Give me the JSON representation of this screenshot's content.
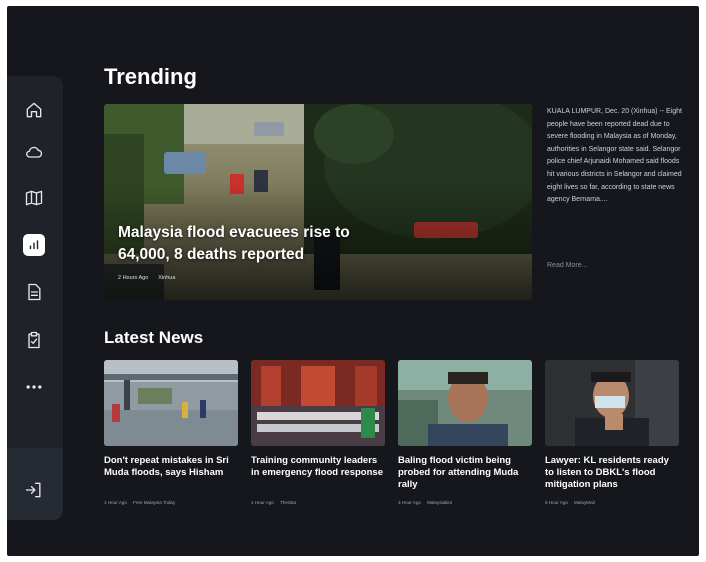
{
  "sections": {
    "trending": "Trending",
    "latest": "Latest News"
  },
  "sidebar": {
    "items": [
      {
        "icon": "home-icon"
      },
      {
        "icon": "cloud-icon"
      },
      {
        "icon": "map-icon"
      },
      {
        "icon": "chart-icon",
        "active": true
      },
      {
        "icon": "document-icon"
      },
      {
        "icon": "clipboard-check-icon"
      },
      {
        "icon": "more-icon"
      }
    ],
    "logout_icon": "logout-icon"
  },
  "featured": {
    "title": "Malaysia flood evacuees rise to 64,000, 8 deaths reported",
    "time": "2 Hours Ago",
    "source": "Xinhua",
    "body": "KUALA LUMPUR, Dec. 20 (Xinhua) -- Eight people have been reported dead due to severe flooding in Malaysia as of Monday, authorities in Selangor state said. Selangor police chief Arjunaidi Mohamed said floods hit various districts in Selangor and claimed eight lives so far, according to state news agency Bernama....",
    "read_more": "Read More..."
  },
  "latest": [
    {
      "title": "Don't repeat mistakes in Sri Muda floods, says Hisham",
      "time": "1 Hour Ago",
      "source": "Free Malaysia Today"
    },
    {
      "title": "Training community leaders in emergency flood response",
      "time": "1 Hour Ago",
      "source": "TheStar"
    },
    {
      "title": "Baling flood victim being probed for attending Muda rally",
      "time": "3 Hour Ago",
      "source": "Malaysiakini"
    },
    {
      "title": "Lawyer: KL residents ready to listen to DBKL's flood mitigation plans",
      "time": "5 Hour Ago",
      "source": "MalayMail"
    }
  ]
}
